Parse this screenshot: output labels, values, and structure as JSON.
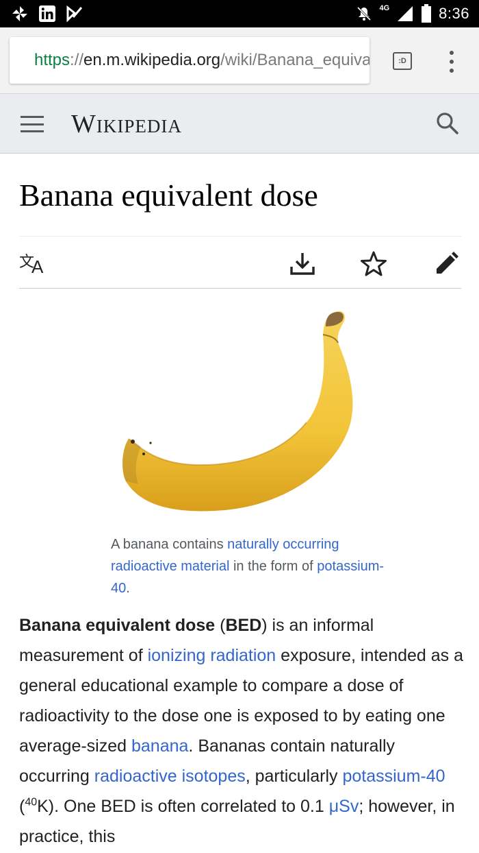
{
  "status_bar": {
    "time": "8:36",
    "network": "4G",
    "left_icons": [
      "pinwheel-app-icon",
      "linkedin-icon",
      "check-app-icon"
    ],
    "right_icons": [
      "mute-icon",
      "signal-icon",
      "battery-icon"
    ]
  },
  "browser": {
    "url_scheme": "https",
    "url_sep": "://",
    "url_host": "en.m.wikipedia.org",
    "url_path": "/wiki/Banana_equivalent_dose",
    "tabs_label": ":D"
  },
  "wiki_header": {
    "wordmark": "Wikipedia"
  },
  "article": {
    "title": "Banana equivalent dose",
    "caption": {
      "t1": "A banana contains ",
      "link1": "naturally occurring radioactive material",
      "t2": " in the form of ",
      "link2": "potassium-40",
      "t3": "."
    },
    "body": {
      "b1": "Banana equivalent dose",
      "t1": " (",
      "b2": "BED",
      "t2": ") is an informal measurement of ",
      "link1": "ionizing radiation",
      "t3": " exposure, intended as a general educational example to compare a dose of radioactivity to the dose one is exposed to by eating one average-sized ",
      "link2": "banana",
      "t4": ". Bananas contain naturally occurring ",
      "link3": "radioactive isotopes",
      "t5": ", particularly ",
      "link4": "potassium-40",
      "t6": " (",
      "sup": "40",
      "t7": "K). One BED is often correlated to 0.1 ",
      "link5": "μSv",
      "t8": "; however, in practice, this"
    }
  },
  "colors": {
    "link": "#3366cc",
    "header_bg": "#eaecf0",
    "lock_green": "#0b8043"
  }
}
